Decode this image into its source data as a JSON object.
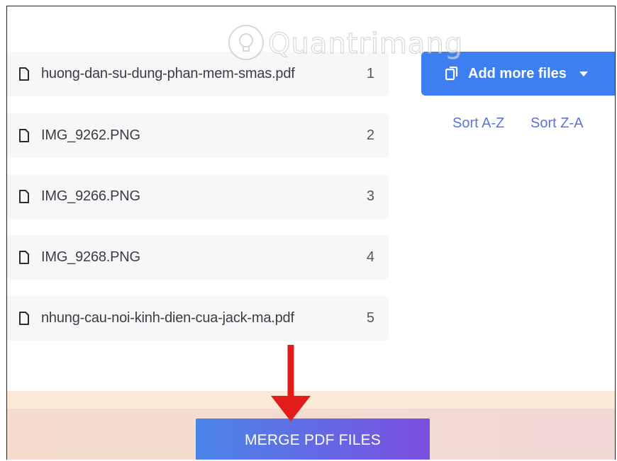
{
  "files": [
    {
      "name": "huong-dan-su-dung-phan-mem-smas.pdf",
      "number": "1"
    },
    {
      "name": "IMG_9262.PNG",
      "number": "2"
    },
    {
      "name": "IMG_9266.PNG",
      "number": "3"
    },
    {
      "name": "IMG_9268.PNG",
      "number": "4"
    },
    {
      "name": "nhung-cau-noi-kinh-dien-cua-jack-ma.pdf",
      "number": "5"
    }
  ],
  "toolbar": {
    "add_label": "Add more files",
    "sort_az": "Sort A-Z",
    "sort_za": "Sort Z-A"
  },
  "merge": {
    "label": "MERGE PDF FILES"
  },
  "watermark": {
    "text": "Quantrimang"
  },
  "colors": {
    "accent": "#3d7ff0",
    "arrow": "#e21b1b",
    "link": "#5b73d8"
  },
  "icons": {
    "file": "file-icon",
    "copy": "copy-icon",
    "dropdown": "chevron-down-icon",
    "arrow": "arrow-down-icon"
  }
}
